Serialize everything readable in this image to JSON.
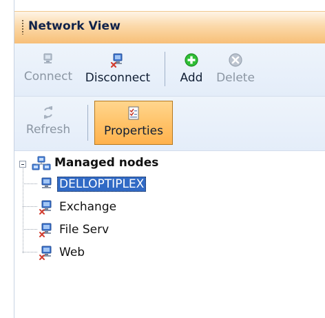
{
  "window": {
    "title": "Network View"
  },
  "toolbar": {
    "row1": [
      {
        "label": "Connect",
        "enabled": false,
        "icon": "connect-computer-icon"
      },
      {
        "label": "Disconnect",
        "enabled": true,
        "icon": "disconnect-computer-icon"
      },
      {
        "label": "Add",
        "enabled": true,
        "icon": "add-icon"
      },
      {
        "label": "Delete",
        "enabled": false,
        "icon": "delete-icon"
      }
    ],
    "row2": [
      {
        "label": "Refresh",
        "enabled": false,
        "icon": "refresh-icon"
      },
      {
        "label": "Properties",
        "enabled": true,
        "pressed": true,
        "icon": "properties-icon"
      }
    ]
  },
  "tree": {
    "root": {
      "label": "Managed nodes",
      "expanded": true,
      "icon": "network-nodes-icon"
    },
    "children": [
      {
        "label": "DELLOPTIPLEX",
        "selected": true,
        "icon": "computer-node-icon"
      },
      {
        "label": "Exchange",
        "selected": false,
        "icon": "computer-node-icon"
      },
      {
        "label": "File Serv",
        "selected": false,
        "icon": "computer-node-icon"
      },
      {
        "label": "Web",
        "selected": false,
        "icon": "computer-node-icon"
      }
    ]
  },
  "colors": {
    "titleGradientTop": "#fef4e6",
    "titleGradientBottom": "#f7bf78",
    "toolbarBg": "#e4edf9",
    "selectedBg": "#316ac5",
    "pressedBg": "#ffc36a",
    "accentGreen": "#29b12c",
    "accentRed": "#cf3d2f",
    "accentBlue": "#2c63c6"
  }
}
